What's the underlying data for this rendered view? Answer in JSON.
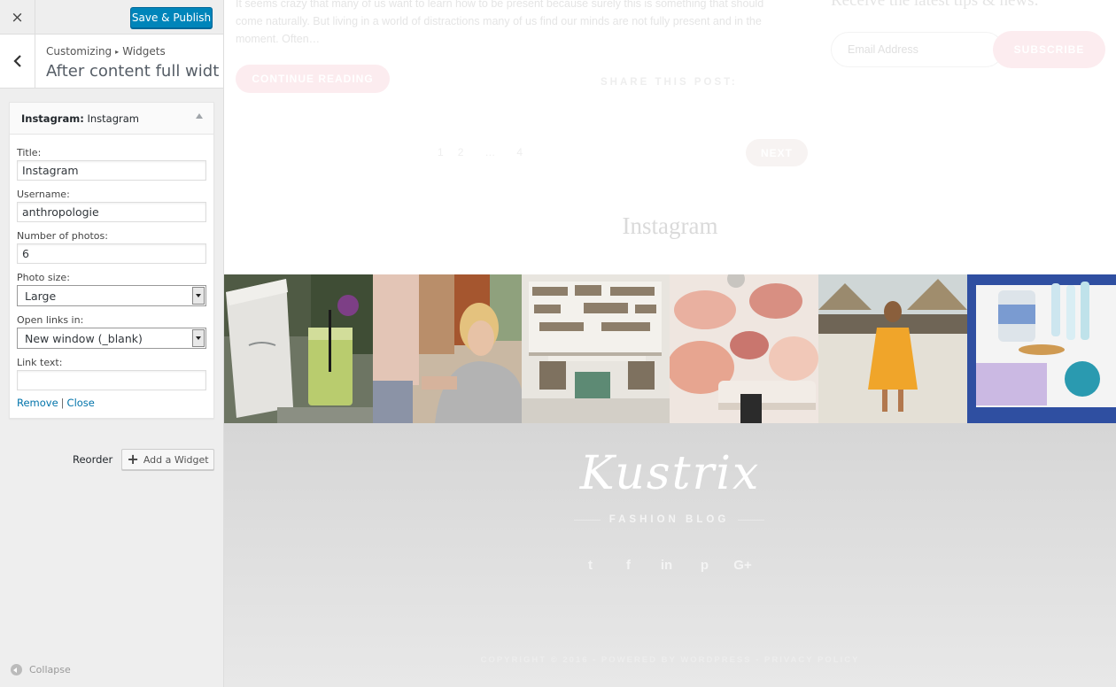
{
  "customizer": {
    "header": {
      "close_icon": "×",
      "save_label": "Save & Publish"
    },
    "section": {
      "back_icon": "chevron-left",
      "breadcrumb_root": "Customizing",
      "breadcrumb_sep": "▸",
      "breadcrumb_leaf": "Widgets",
      "title": "After content full width ..."
    },
    "widget": {
      "title_prefix": "Instagram:",
      "title_name": "Instagram",
      "fields": {
        "title_label": "Title:",
        "title_value": "Instagram",
        "username_label": "Username:",
        "username_value": "anthropologie",
        "photos_label": "Number of photos:",
        "photos_value": "6",
        "size_label": "Photo size:",
        "size_value": "Large",
        "links_label": "Open links in:",
        "links_value": "New window (_blank)",
        "linktext_label": "Link text:",
        "linktext_value": ""
      },
      "actions": {
        "remove": "Remove",
        "sep": "|",
        "close": "Close"
      }
    },
    "reorder_label": "Reorder",
    "add_widget_label": "Add a Widget",
    "collapse_label": "Collapse",
    "colors": {
      "primary_button": "#0085ba",
      "link": "#0073aa",
      "panel_bg": "#eeeeee"
    }
  },
  "preview": {
    "excerpt": "It seems crazy that many of us want to learn how to be present because surely this is something that should come naturally. But living in a world of distractions many of us find our minds are not fully present and in the moment. Often…",
    "continue_label": "CONTINUE READING",
    "share_label": "SHARE THIS POST:",
    "pagination": [
      "1",
      "2",
      "…",
      "4"
    ],
    "next_label": "NEXT",
    "newsletter": {
      "title": "Receive the latest tips & news:",
      "email_placeholder": "Email Address",
      "subscribe_label": "SUBSCRIBE"
    },
    "instagram_heading": "Instagram",
    "footer": {
      "logo": "Kustrix",
      "tagline": "FASHION BLOG",
      "socials": [
        "twitter-icon",
        "facebook-icon",
        "linkedin-icon",
        "pinterest-icon",
        "google-plus-icon"
      ],
      "social_glyphs": [
        "t",
        "f",
        "in",
        "p",
        "G+"
      ],
      "copyright": "COPYRIGHT © 2016 - POWERED BY WORDPRESS - PRIVACY POLICY"
    },
    "colors": {
      "accent_pink": "#fcecef",
      "footer_bg": "#d6d6d6"
    }
  }
}
